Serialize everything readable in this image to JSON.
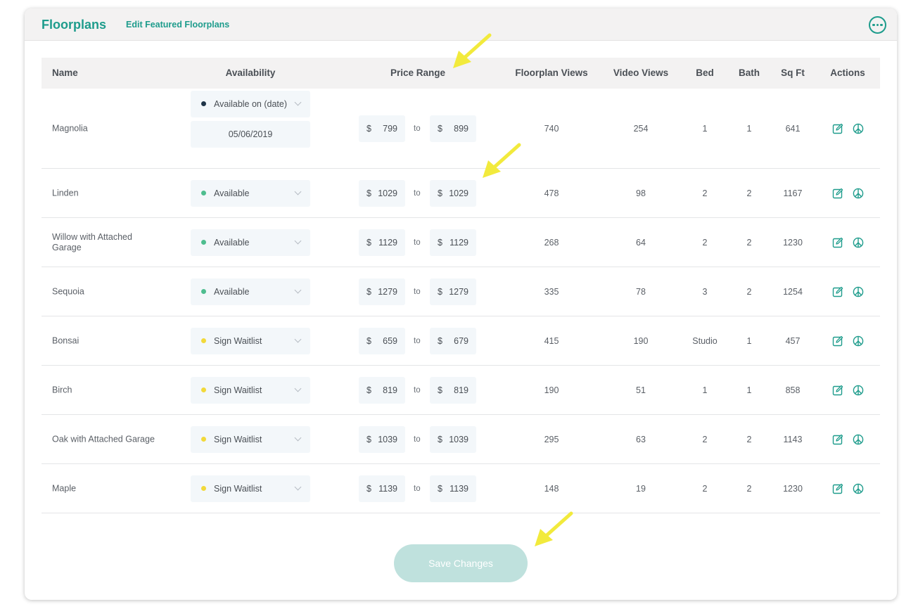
{
  "header": {
    "title": "Floorplans",
    "edit_link": "Edit Featured Floorplans",
    "more_icon": "more-horizontal-icon"
  },
  "colors": {
    "accent": "#1e9c8c",
    "dark_dot": "#1f3448",
    "available_dot": "#4ebd8f",
    "waitlist_dot": "#f2d93a",
    "save_button_bg": "#bfe1dd",
    "annotation_arrow": "#f2ea3c"
  },
  "columns": {
    "name": "Name",
    "availability": "Availability",
    "price_range": "Price Range",
    "floorplan_views": "Floorplan Views",
    "video_views": "Video Views",
    "bed": "Bed",
    "bath": "Bath",
    "sqft": "Sq Ft",
    "actions": "Actions"
  },
  "currency_symbol": "$",
  "to_label": "to",
  "rows": [
    {
      "name": "Magnolia",
      "availability": "Available on (date)",
      "status": "dark",
      "date": "05/06/2019",
      "price_from": "799",
      "price_to": "899",
      "floorplan_views": "740",
      "video_views": "254",
      "bed": "1",
      "bath": "1",
      "sqft": "641"
    },
    {
      "name": "Linden",
      "availability": "Available",
      "status": "available",
      "price_from": "1029",
      "price_to": "1029",
      "floorplan_views": "478",
      "video_views": "98",
      "bed": "2",
      "bath": "2",
      "sqft": "1167"
    },
    {
      "name": "Willow with Attached Garage",
      "availability": "Available",
      "status": "available",
      "price_from": "1129",
      "price_to": "1129",
      "floorplan_views": "268",
      "video_views": "64",
      "bed": "2",
      "bath": "2",
      "sqft": "1230"
    },
    {
      "name": "Sequoia",
      "availability": "Available",
      "status": "available",
      "price_from": "1279",
      "price_to": "1279",
      "floorplan_views": "335",
      "video_views": "78",
      "bed": "3",
      "bath": "2",
      "sqft": "1254"
    },
    {
      "name": "Bonsai",
      "availability": "Sign Waitlist",
      "status": "waitlist",
      "price_from": "659",
      "price_to": "679",
      "floorplan_views": "415",
      "video_views": "190",
      "bed": "Studio",
      "bath": "1",
      "sqft": "457"
    },
    {
      "name": "Birch",
      "availability": "Sign Waitlist",
      "status": "waitlist",
      "price_from": "819",
      "price_to": "819",
      "floorplan_views": "190",
      "video_views": "51",
      "bed": "1",
      "bath": "1",
      "sqft": "858"
    },
    {
      "name": "Oak with Attached Garage",
      "availability": "Sign Waitlist",
      "status": "waitlist",
      "price_from": "1039",
      "price_to": "1039",
      "floorplan_views": "295",
      "video_views": "63",
      "bed": "2",
      "bath": "2",
      "sqft": "1143"
    },
    {
      "name": "Maple",
      "availability": "Sign Waitlist",
      "status": "waitlist",
      "price_from": "1139",
      "price_to": "1139",
      "floorplan_views": "148",
      "video_views": "19",
      "bed": "2",
      "bath": "2",
      "sqft": "1230"
    }
  ],
  "action_icons": {
    "edit": "edit-icon",
    "secondary": "peace-icon"
  },
  "save_button": "Save Changes"
}
